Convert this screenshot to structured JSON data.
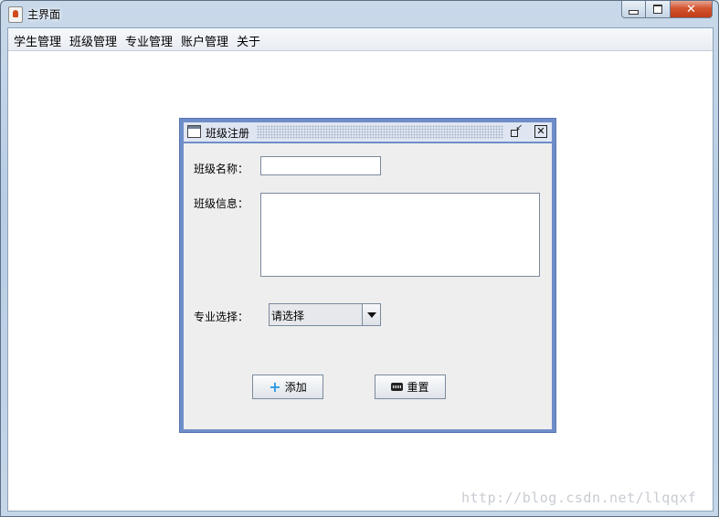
{
  "window": {
    "title": "主界面",
    "close_glyph": "✕"
  },
  "menu": [
    {
      "label": "学生管理"
    },
    {
      "label": "班级管理"
    },
    {
      "label": "专业管理"
    },
    {
      "label": "账户管理"
    },
    {
      "label": "关于"
    }
  ],
  "dialog": {
    "title": "班级注册",
    "close_glyph": "✕",
    "restore_glyph": "↙",
    "fields": {
      "class_name_label": "班级名称：",
      "class_name_value": "",
      "class_info_label": "班级信息：",
      "class_info_value": "",
      "major_label": "专业选择：",
      "major_selected": "请选择"
    },
    "buttons": {
      "add_label": "添加",
      "add_icon": "+",
      "reset_label": "重置"
    }
  },
  "watermark": "http://blog.csdn.net/llqqxf",
  "colors": {
    "dialog_border": "#6f8dc8",
    "dialog_body": "#eeeeee",
    "close_button": "#c23a18"
  }
}
